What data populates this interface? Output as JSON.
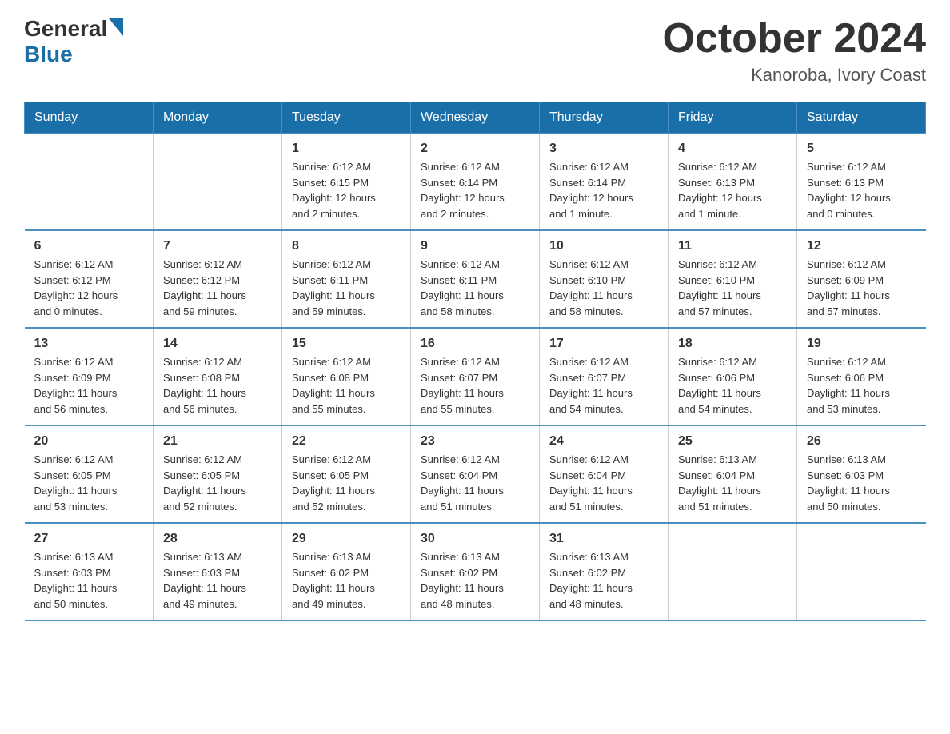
{
  "logo": {
    "general": "General",
    "blue": "Blue"
  },
  "title": "October 2024",
  "subtitle": "Kanoroba, Ivory Coast",
  "days_header": [
    "Sunday",
    "Monday",
    "Tuesday",
    "Wednesday",
    "Thursday",
    "Friday",
    "Saturday"
  ],
  "weeks": [
    [
      {
        "day": "",
        "info": ""
      },
      {
        "day": "",
        "info": ""
      },
      {
        "day": "1",
        "info": "Sunrise: 6:12 AM\nSunset: 6:15 PM\nDaylight: 12 hours\nand 2 minutes."
      },
      {
        "day": "2",
        "info": "Sunrise: 6:12 AM\nSunset: 6:14 PM\nDaylight: 12 hours\nand 2 minutes."
      },
      {
        "day": "3",
        "info": "Sunrise: 6:12 AM\nSunset: 6:14 PM\nDaylight: 12 hours\nand 1 minute."
      },
      {
        "day": "4",
        "info": "Sunrise: 6:12 AM\nSunset: 6:13 PM\nDaylight: 12 hours\nand 1 minute."
      },
      {
        "day": "5",
        "info": "Sunrise: 6:12 AM\nSunset: 6:13 PM\nDaylight: 12 hours\nand 0 minutes."
      }
    ],
    [
      {
        "day": "6",
        "info": "Sunrise: 6:12 AM\nSunset: 6:12 PM\nDaylight: 12 hours\nand 0 minutes."
      },
      {
        "day": "7",
        "info": "Sunrise: 6:12 AM\nSunset: 6:12 PM\nDaylight: 11 hours\nand 59 minutes."
      },
      {
        "day": "8",
        "info": "Sunrise: 6:12 AM\nSunset: 6:11 PM\nDaylight: 11 hours\nand 59 minutes."
      },
      {
        "day": "9",
        "info": "Sunrise: 6:12 AM\nSunset: 6:11 PM\nDaylight: 11 hours\nand 58 minutes."
      },
      {
        "day": "10",
        "info": "Sunrise: 6:12 AM\nSunset: 6:10 PM\nDaylight: 11 hours\nand 58 minutes."
      },
      {
        "day": "11",
        "info": "Sunrise: 6:12 AM\nSunset: 6:10 PM\nDaylight: 11 hours\nand 57 minutes."
      },
      {
        "day": "12",
        "info": "Sunrise: 6:12 AM\nSunset: 6:09 PM\nDaylight: 11 hours\nand 57 minutes."
      }
    ],
    [
      {
        "day": "13",
        "info": "Sunrise: 6:12 AM\nSunset: 6:09 PM\nDaylight: 11 hours\nand 56 minutes."
      },
      {
        "day": "14",
        "info": "Sunrise: 6:12 AM\nSunset: 6:08 PM\nDaylight: 11 hours\nand 56 minutes."
      },
      {
        "day": "15",
        "info": "Sunrise: 6:12 AM\nSunset: 6:08 PM\nDaylight: 11 hours\nand 55 minutes."
      },
      {
        "day": "16",
        "info": "Sunrise: 6:12 AM\nSunset: 6:07 PM\nDaylight: 11 hours\nand 55 minutes."
      },
      {
        "day": "17",
        "info": "Sunrise: 6:12 AM\nSunset: 6:07 PM\nDaylight: 11 hours\nand 54 minutes."
      },
      {
        "day": "18",
        "info": "Sunrise: 6:12 AM\nSunset: 6:06 PM\nDaylight: 11 hours\nand 54 minutes."
      },
      {
        "day": "19",
        "info": "Sunrise: 6:12 AM\nSunset: 6:06 PM\nDaylight: 11 hours\nand 53 minutes."
      }
    ],
    [
      {
        "day": "20",
        "info": "Sunrise: 6:12 AM\nSunset: 6:05 PM\nDaylight: 11 hours\nand 53 minutes."
      },
      {
        "day": "21",
        "info": "Sunrise: 6:12 AM\nSunset: 6:05 PM\nDaylight: 11 hours\nand 52 minutes."
      },
      {
        "day": "22",
        "info": "Sunrise: 6:12 AM\nSunset: 6:05 PM\nDaylight: 11 hours\nand 52 minutes."
      },
      {
        "day": "23",
        "info": "Sunrise: 6:12 AM\nSunset: 6:04 PM\nDaylight: 11 hours\nand 51 minutes."
      },
      {
        "day": "24",
        "info": "Sunrise: 6:12 AM\nSunset: 6:04 PM\nDaylight: 11 hours\nand 51 minutes."
      },
      {
        "day": "25",
        "info": "Sunrise: 6:13 AM\nSunset: 6:04 PM\nDaylight: 11 hours\nand 51 minutes."
      },
      {
        "day": "26",
        "info": "Sunrise: 6:13 AM\nSunset: 6:03 PM\nDaylight: 11 hours\nand 50 minutes."
      }
    ],
    [
      {
        "day": "27",
        "info": "Sunrise: 6:13 AM\nSunset: 6:03 PM\nDaylight: 11 hours\nand 50 minutes."
      },
      {
        "day": "28",
        "info": "Sunrise: 6:13 AM\nSunset: 6:03 PM\nDaylight: 11 hours\nand 49 minutes."
      },
      {
        "day": "29",
        "info": "Sunrise: 6:13 AM\nSunset: 6:02 PM\nDaylight: 11 hours\nand 49 minutes."
      },
      {
        "day": "30",
        "info": "Sunrise: 6:13 AM\nSunset: 6:02 PM\nDaylight: 11 hours\nand 48 minutes."
      },
      {
        "day": "31",
        "info": "Sunrise: 6:13 AM\nSunset: 6:02 PM\nDaylight: 11 hours\nand 48 minutes."
      },
      {
        "day": "",
        "info": ""
      },
      {
        "day": "",
        "info": ""
      }
    ]
  ]
}
